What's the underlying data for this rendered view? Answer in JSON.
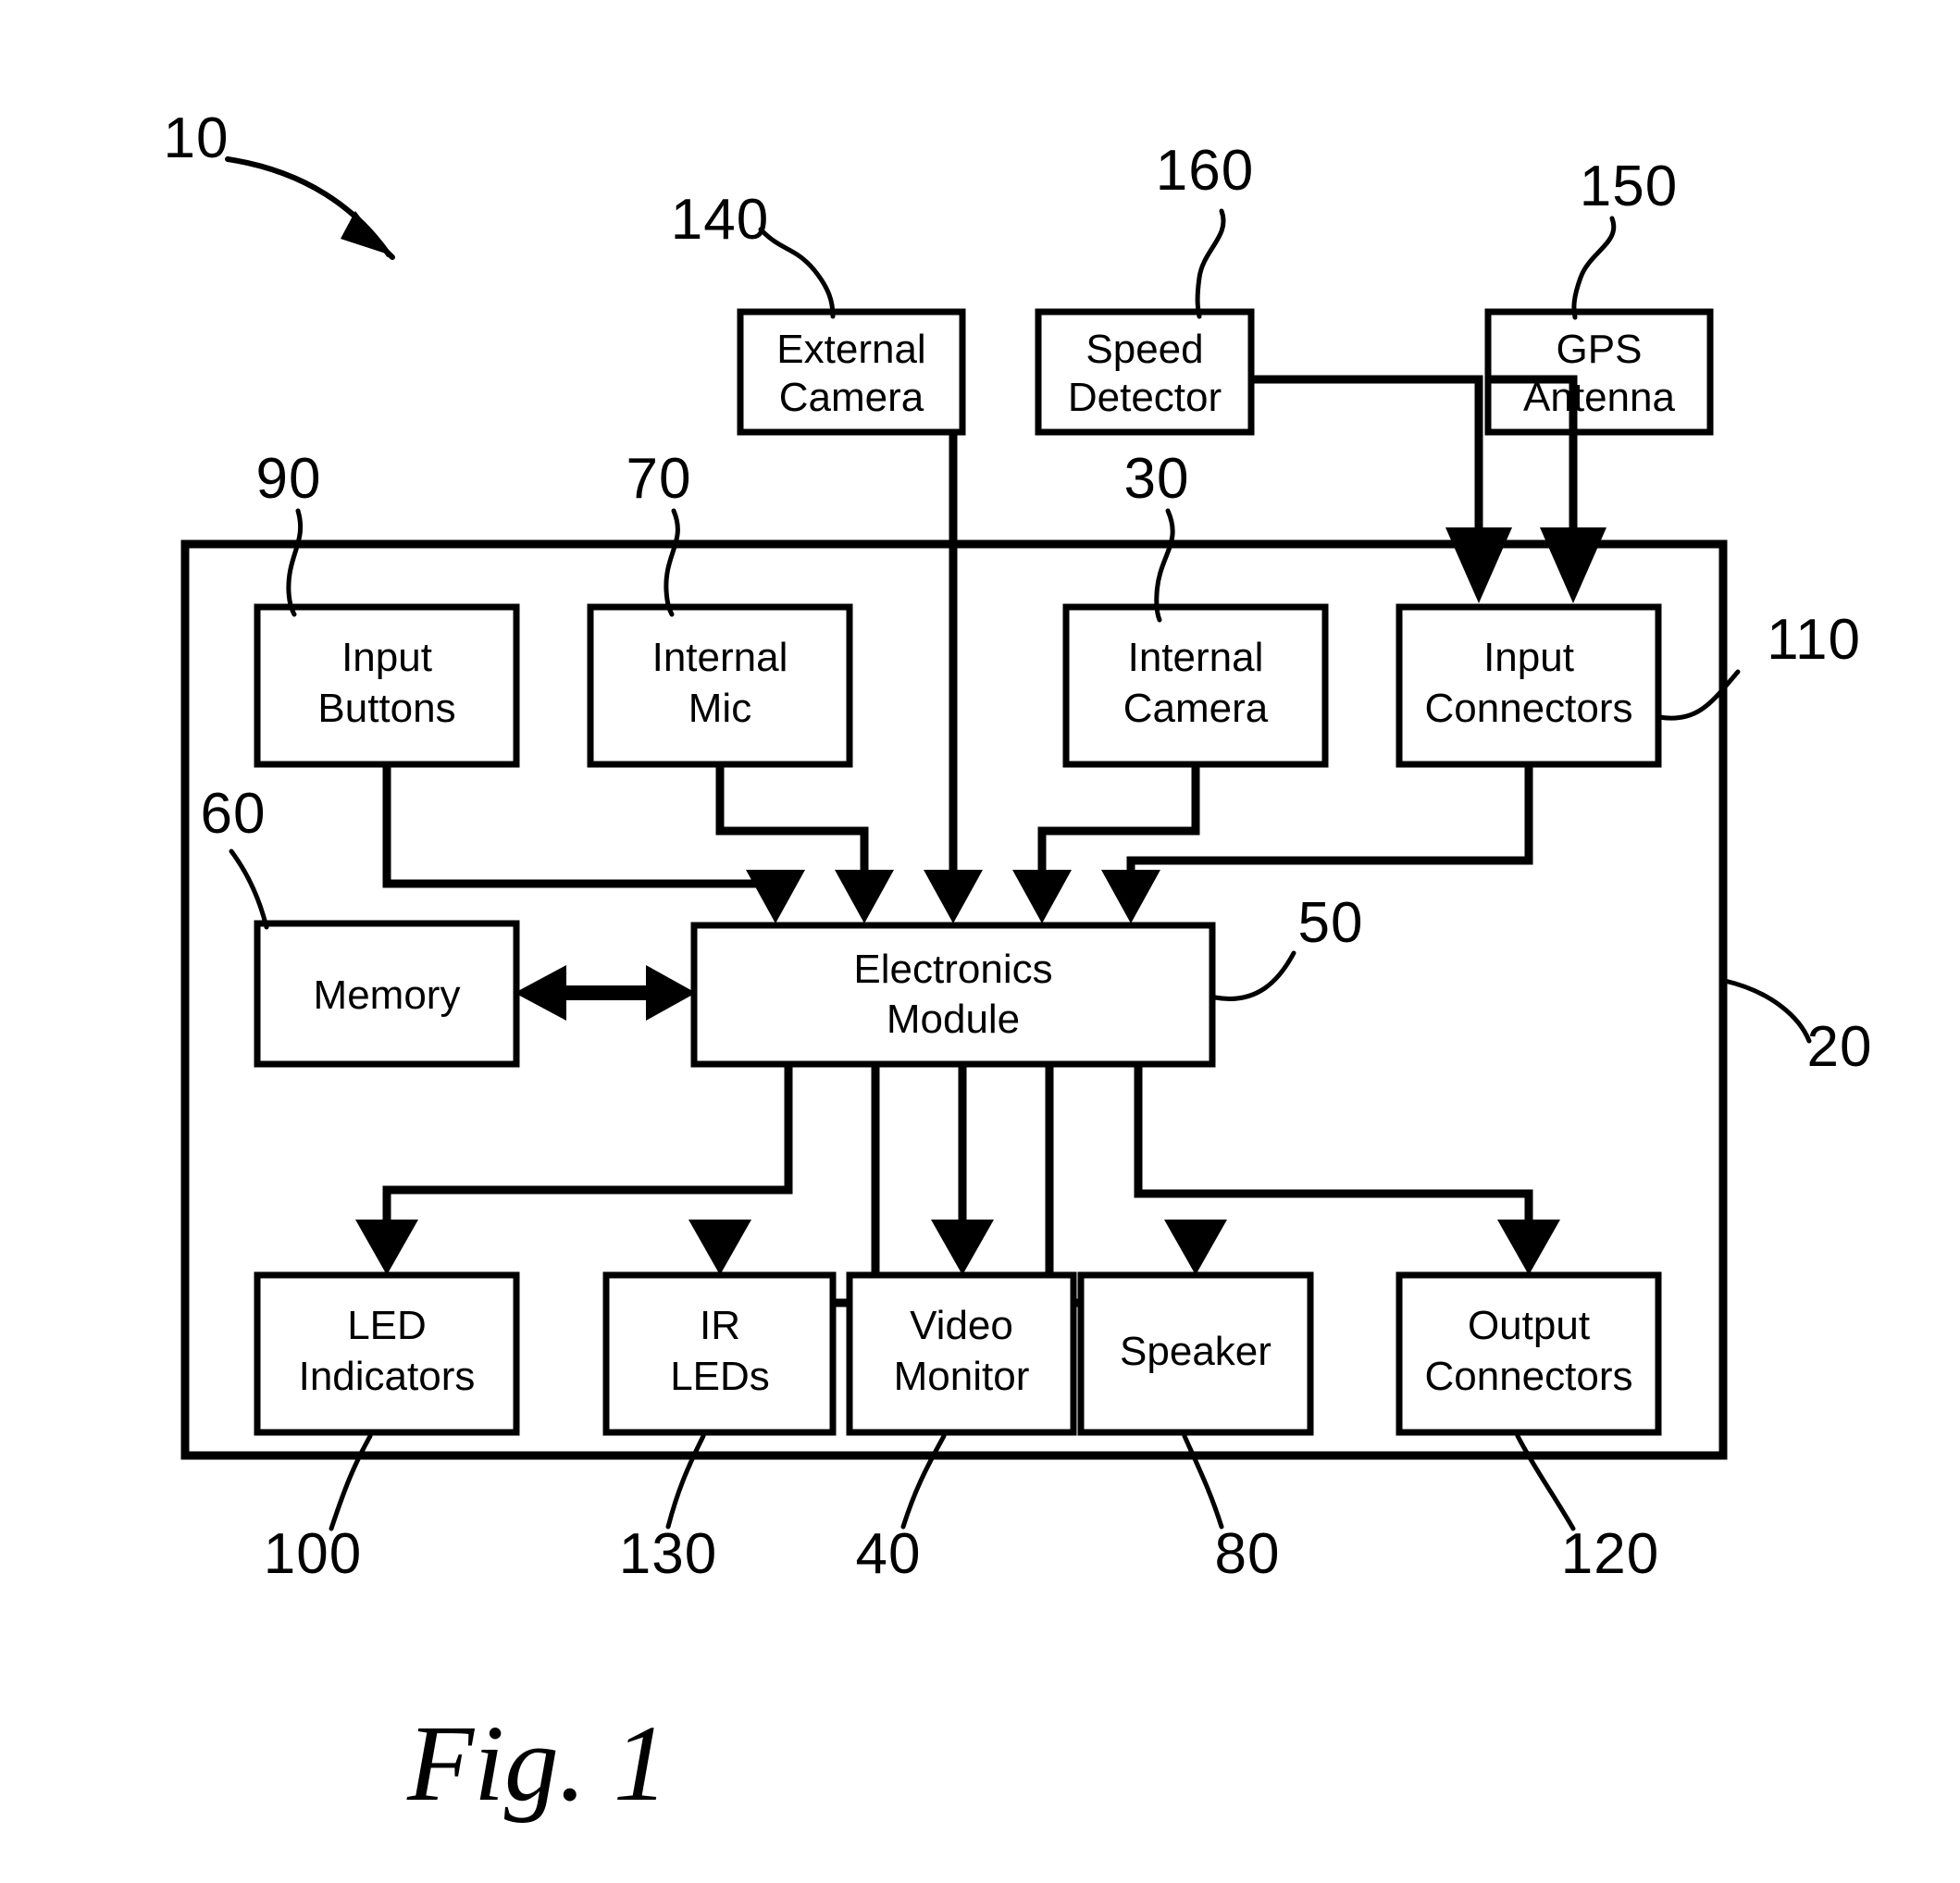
{
  "figure": {
    "caption": "Fig. 1",
    "system_ref": "10"
  },
  "external_blocks": [
    {
      "id": "external-camera",
      "lines": [
        "External",
        "Camera"
      ],
      "ref": "140"
    },
    {
      "id": "speed-detector",
      "lines": [
        "Speed",
        "Detector"
      ],
      "ref": "160"
    },
    {
      "id": "gps-antenna",
      "lines": [
        "GPS",
        "Antenna"
      ],
      "ref": "150"
    }
  ],
  "enclosure": {
    "id": "device-enclosure",
    "ref": "20"
  },
  "input_blocks": [
    {
      "id": "input-buttons",
      "lines": [
        "Input",
        "Buttons"
      ],
      "ref": "90"
    },
    {
      "id": "internal-mic",
      "lines": [
        "Internal",
        "Mic"
      ],
      "ref": "70"
    },
    {
      "id": "internal-camera",
      "lines": [
        "Internal",
        "Camera"
      ],
      "ref": "30"
    },
    {
      "id": "input-connectors",
      "lines": [
        "Input",
        "Connectors"
      ],
      "ref": "110"
    }
  ],
  "core_blocks": [
    {
      "id": "memory",
      "lines": [
        "Memory"
      ],
      "ref": "60"
    },
    {
      "id": "electronics-module",
      "lines": [
        "Electronics",
        "Module"
      ],
      "ref": "50"
    }
  ],
  "output_blocks": [
    {
      "id": "led-indicators",
      "lines": [
        "LED",
        "Indicators"
      ],
      "ref": "100"
    },
    {
      "id": "ir-leds",
      "lines": [
        "IR",
        "LEDs"
      ],
      "ref": "130"
    },
    {
      "id": "video-monitor",
      "lines": [
        "Video",
        "Monitor"
      ],
      "ref": "40"
    },
    {
      "id": "speaker",
      "lines": [
        "Speaker"
      ],
      "ref": "80"
    },
    {
      "id": "output-connectors",
      "lines": [
        "Output",
        "Connectors"
      ],
      "ref": "120"
    }
  ],
  "labels": {
    "external_camera_l1": "External",
    "external_camera_l2": "Camera",
    "speed_detector_l1": "Speed",
    "speed_detector_l2": "Detector",
    "gps_antenna_l1": "GPS",
    "gps_antenna_l2": "Antenna",
    "input_buttons_l1": "Input",
    "input_buttons_l2": "Buttons",
    "internal_mic_l1": "Internal",
    "internal_mic_l2": "Mic",
    "internal_camera_l1": "Internal",
    "internal_camera_l2": "Camera",
    "input_connectors_l1": "Input",
    "input_connectors_l2": "Connectors",
    "memory_l1": "Memory",
    "electronics_module_l1": "Electronics",
    "electronics_module_l2": "Module",
    "led_indicators_l1": "LED",
    "led_indicators_l2": "Indicators",
    "ir_leds_l1": "IR",
    "ir_leds_l2": "LEDs",
    "video_monitor_l1": "Video",
    "video_monitor_l2": "Monitor",
    "speaker_l1": "Speaker",
    "output_connectors_l1": "Output",
    "output_connectors_l2": "Connectors"
  },
  "refs": {
    "system": "10",
    "enclosure": "20",
    "internal_camera": "30",
    "video_monitor": "40",
    "electronics_module": "50",
    "memory": "60",
    "internal_mic": "70",
    "speaker": "80",
    "input_buttons": "90",
    "led_indicators": "100",
    "input_connectors": "110",
    "output_connectors": "120",
    "ir_leds": "130",
    "external_camera": "140",
    "gps_antenna": "150",
    "speed_detector": "160"
  },
  "colors": {
    "ink": "#000000",
    "paper": "#ffffff"
  }
}
